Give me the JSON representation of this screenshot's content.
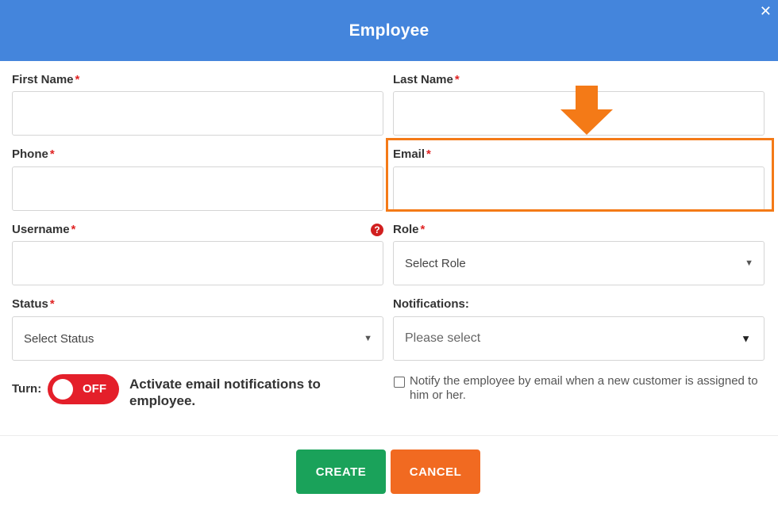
{
  "dialog": {
    "title": "Employee",
    "close_glyph": "✕"
  },
  "form": {
    "required_mark": "*",
    "first_name": {
      "label": "First Name",
      "value": "",
      "placeholder": ""
    },
    "last_name": {
      "label": "Last Name",
      "value": "",
      "placeholder": ""
    },
    "phone": {
      "label": "Phone",
      "value": "",
      "placeholder": ""
    },
    "email": {
      "label": "Email",
      "value": "",
      "placeholder": ""
    },
    "username": {
      "label": "Username",
      "value": "",
      "placeholder": "",
      "help_glyph": "?"
    },
    "role": {
      "label": "Role",
      "selected": "Select Role"
    },
    "status": {
      "label": "Status",
      "selected": "Select Status"
    },
    "notifications": {
      "label": "Notifications:",
      "selected": "Please select"
    },
    "toggle": {
      "label": "Turn:",
      "state_text": "OFF",
      "description": "Activate email notifications to employee."
    },
    "notify_checkbox": {
      "checked": false,
      "label": "Notify the employee by email when a new customer is assigned to him or her."
    }
  },
  "buttons": {
    "create": "CREATE",
    "cancel": "CANCEL"
  },
  "colors": {
    "header": "#4485dc",
    "required": "#e02424",
    "highlight": "#f47a17",
    "toggle_off": "#e41f2a",
    "create": "#1aa25a",
    "cancel": "#f16a21"
  },
  "icons": {
    "close": "close-icon",
    "help": "help-circle-icon",
    "caret": "caret-down-icon",
    "annotation_arrow": "arrow-down-icon"
  }
}
